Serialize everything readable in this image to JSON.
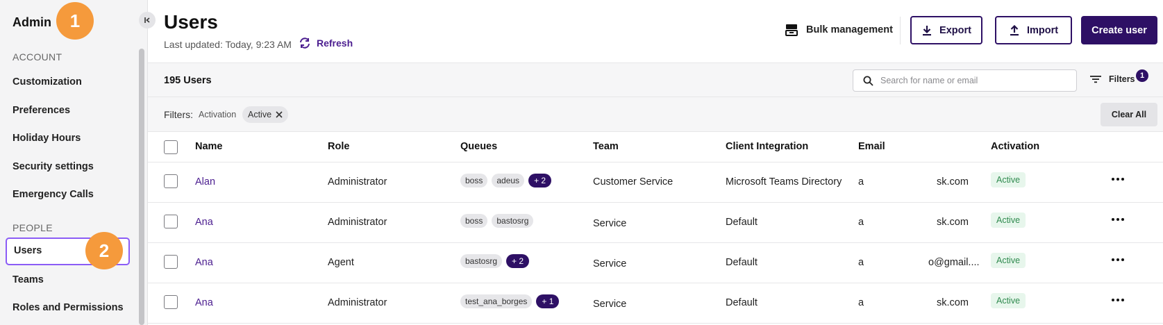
{
  "sidebar": {
    "title": "Admin",
    "markers": [
      "1",
      "2"
    ],
    "sections": [
      {
        "label": "ACCOUNT",
        "items": [
          "Customization",
          "Preferences",
          "Holiday Hours",
          "Security settings",
          "Emergency Calls"
        ]
      },
      {
        "label": "PEOPLE",
        "items": [
          "Users",
          "Teams",
          "Roles and Permissions"
        ]
      }
    ],
    "active_item": "Users"
  },
  "header": {
    "title": "Users",
    "last_updated": "Last updated: Today, 9:23 AM",
    "refresh_label": "Refresh",
    "bulk_label": "Bulk management",
    "export_label": "Export",
    "import_label": "Import",
    "create_label": "Create user"
  },
  "toolbar": {
    "count": "195 Users",
    "search_placeholder": "Search for name or email",
    "filters_label": "Filters",
    "filters_count": "1"
  },
  "filterbar": {
    "label": "Filters:",
    "category": "Activation",
    "chip": "Active",
    "clear_label": "Clear All"
  },
  "table": {
    "columns": [
      "Name",
      "Role",
      "Queues",
      "Team",
      "Client Integration",
      "Email",
      "Activation"
    ],
    "rows": [
      {
        "name": "Alan",
        "role": "Administrator",
        "queues": [
          "boss",
          "adeus"
        ],
        "more": "+ 2",
        "team": "Customer Service",
        "integration": "Microsoft Teams Directory",
        "email_a": "a",
        "email_b": "sk.com",
        "activation": "Active"
      },
      {
        "name": "Ana",
        "role": "Administrator",
        "queues": [
          "boss",
          "bastosrg"
        ],
        "more": "",
        "team": "Service",
        "integration": "Default",
        "email_a": "a",
        "email_b": "sk.com",
        "activation": "Active"
      },
      {
        "name": "Ana",
        "role": "Agent",
        "queues": [
          "bastosrg"
        ],
        "more": "+ 2",
        "team": "Service",
        "integration": "Default",
        "email_a": "a",
        "email_b": "o@gmail....",
        "activation": "Active"
      },
      {
        "name": "Ana",
        "role": "Administrator",
        "queues": [
          "test_ana_borges"
        ],
        "more": "+ 1",
        "team": "Service",
        "integration": "Default",
        "email_a": "a",
        "email_b": "sk.com",
        "activation": "Active"
      }
    ]
  },
  "colors": {
    "accent": "#2e1065",
    "link": "#4b1d8f",
    "marker": "#f59a3c",
    "active_border": "#8b5cf6",
    "status_bg": "#e7f6ec",
    "status_text": "#2f8a4e"
  },
  "icons": [
    "collapse-icon",
    "refresh-icon",
    "bulk-icon",
    "download-icon",
    "upload-icon",
    "search-icon",
    "filter-icon",
    "close-icon",
    "kebab-icon"
  ]
}
